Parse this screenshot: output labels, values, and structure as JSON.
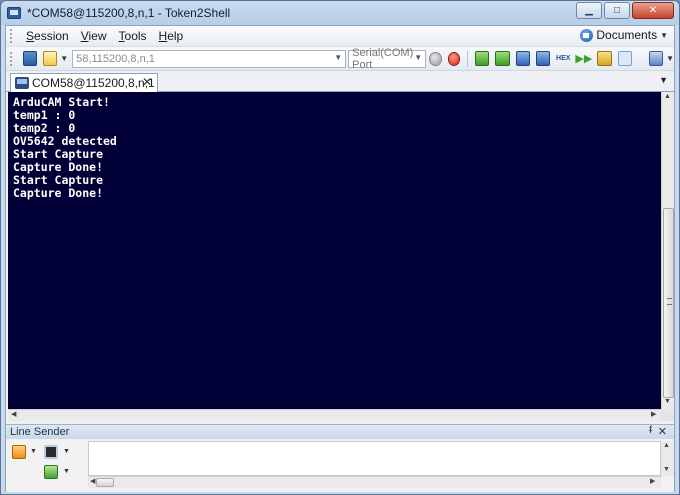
{
  "window": {
    "title": "*COM58@115200,8,n,1 - Token2Shell",
    "minimize_glyph": "▁",
    "maximize_glyph": "□",
    "close_glyph": "✕"
  },
  "menu": {
    "items": [
      {
        "label": "Session"
      },
      {
        "label": "View"
      },
      {
        "label": "Tools"
      },
      {
        "label": "Help"
      }
    ],
    "documents_label": "Documents"
  },
  "toolbar": {
    "address_value": "58,115200,8,n,1",
    "port_type": "Serial(COM) Port",
    "hex_label": "HEX",
    "ff_glyph": "▶▶"
  },
  "tabs": [
    {
      "label": "COM58@115200,8,n,1",
      "close_glyph": "✕"
    }
  ],
  "terminal": {
    "lines": [
      "ArduCAM Start!",
      "temp1 : 0",
      "temp2 : 0",
      "OV5642 detected",
      "Start Capture",
      "Capture Done!",
      "Start Capture",
      "Capture Done!"
    ],
    "background": "#000037",
    "foreground": "#ffffff"
  },
  "line_sender": {
    "title": "Line Sender",
    "pin_glyph": "ᵮ",
    "close_glyph": "✕"
  },
  "icons": {
    "app": "terminal-app-icon",
    "home": "home-icon"
  }
}
